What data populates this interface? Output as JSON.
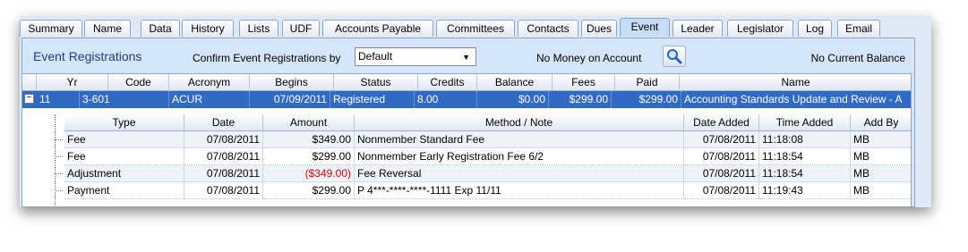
{
  "tabs": [
    "Summary",
    "Name",
    "Data",
    "History",
    "Lists",
    "UDF",
    "Accounts Payable",
    "Committees",
    "Contacts",
    "Dues",
    "Event",
    "Leader",
    "Legislator",
    "Log",
    "Email"
  ],
  "active_tab": "Event",
  "panel": {
    "title": "Event Registrations",
    "confirm_label": "Confirm Event Registrations by",
    "confirm_value": "Default",
    "no_money": "No Money on Account",
    "no_balance": "No Current Balance"
  },
  "grid": {
    "headers": [
      "Yr",
      "Code",
      "Acronym",
      "Begins",
      "Status",
      "Credits",
      "Balance",
      "Fees",
      "Paid",
      "Name"
    ],
    "row": {
      "expander": "−",
      "yr": "11",
      "code": "3-601",
      "acronym": "ACUR",
      "begins": "07/09/2011",
      "status": "Registered",
      "credits": "8.00",
      "balance": "$0.00",
      "fees": "$299.00",
      "paid": "$299.00",
      "name": "Accounting Standards Update and Review - A"
    }
  },
  "subgrid": {
    "headers": [
      "Type",
      "Date",
      "Amount",
      "Method / Note",
      "Date Added",
      "Time Added",
      "Add By"
    ],
    "rows": [
      {
        "type": "Fee",
        "date": "07/08/2011",
        "amount": "$349.00",
        "note": "Nonmember Standard Fee",
        "date_added": "07/08/2011",
        "time_added": "11:18:08",
        "add_by": "MB"
      },
      {
        "type": "Fee",
        "date": "07/08/2011",
        "amount": "$299.00",
        "note": "Nonmember Early Registration Fee  6/2",
        "date_added": "07/08/2011",
        "time_added": "11:18:54",
        "add_by": "MB"
      },
      {
        "type": "Adjustment",
        "date": "07/08/2011",
        "amount": "($349.00)",
        "note": "Fee Reversal",
        "date_added": "07/08/2011",
        "time_added": "11:18:54",
        "add_by": "MB"
      },
      {
        "type": "Payment",
        "date": "07/08/2011",
        "amount": "$299.00",
        "note": "P 4***-****-****-1111 Exp 11/11",
        "date_added": "07/08/2011",
        "time_added": "11:19:43",
        "add_by": "MB"
      }
    ]
  },
  "colors": {
    "selected_row": "#316ac5",
    "negative": "#e00000",
    "title": "#1e3d7a"
  },
  "icons": {
    "search_button": "magnifier-icon"
  }
}
